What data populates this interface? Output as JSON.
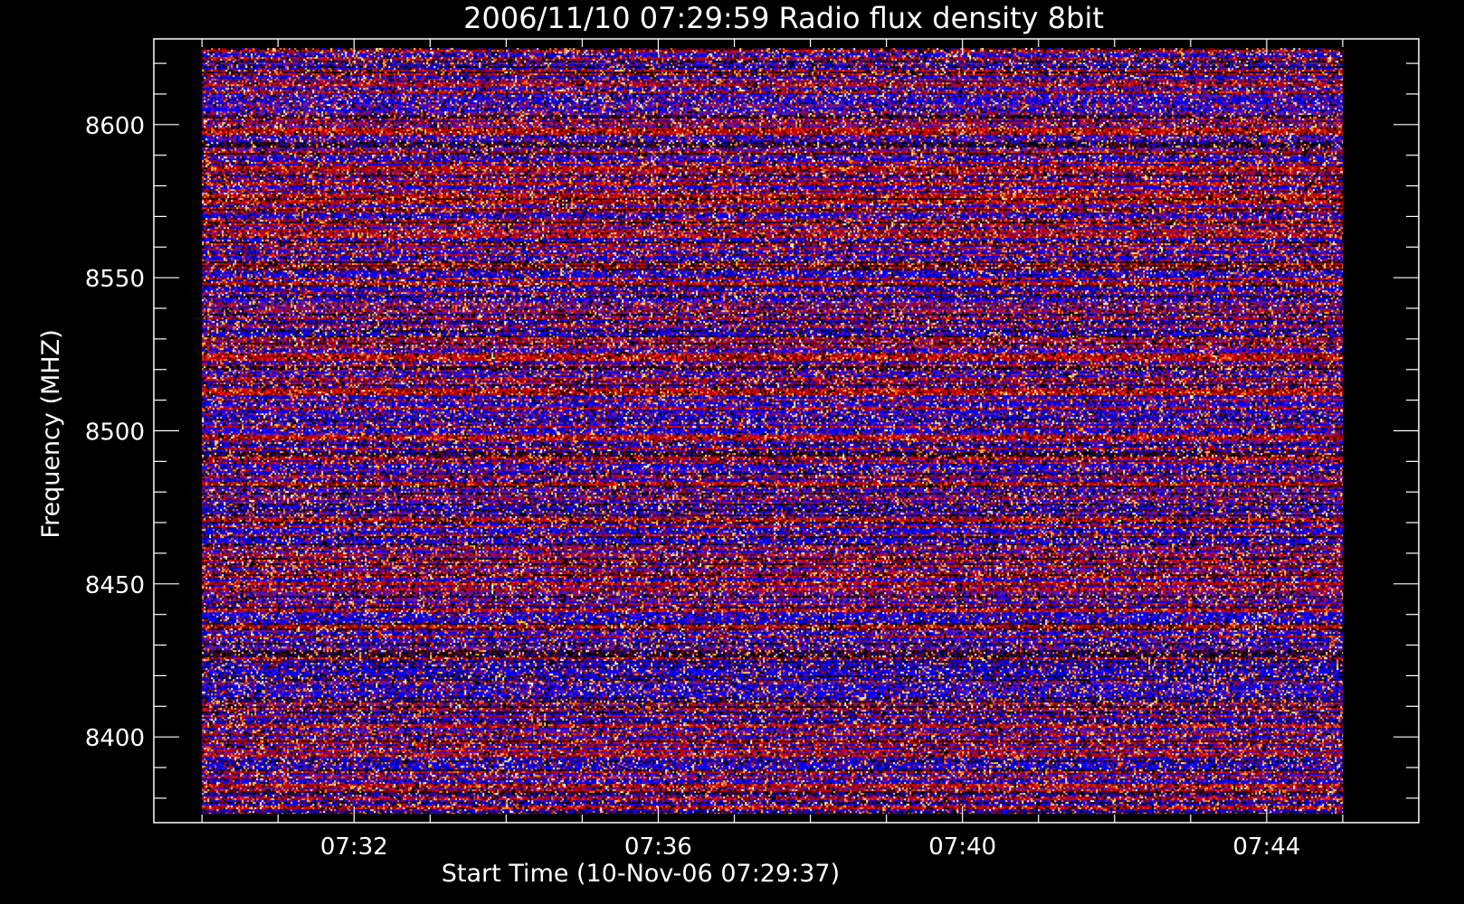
{
  "chart_data": {
    "type": "heatmap",
    "title": "2006/11/10 07:29:59 Radio flux density 8bit",
    "xlabel": "Start Time (10-Nov-06 07:29:37)",
    "ylabel": "Frequency (MHZ)",
    "x_tick_labels": [
      "07:32",
      "07:36",
      "07:40",
      "07:44"
    ],
    "y_tick_labels": [
      "8400",
      "8450",
      "8500",
      "8550",
      "8600"
    ],
    "y_ticks": [
      8400,
      8450,
      8500,
      8550,
      8600
    ],
    "xlim": [
      "07:29:22",
      "07:46:00"
    ],
    "ylim": [
      8628,
      8372
    ],
    "data_time_range": [
      "07:30:00",
      "07:45:00"
    ],
    "data_freq_range": [
      8375,
      8625
    ],
    "colors": {
      "background": "#000000",
      "axes": "#ffffff",
      "text": "#ffffff",
      "colormap": [
        "#000000",
        "#3a0a2a",
        "#7a0000",
        "#c80000",
        "#ff2a00",
        "#ff7a20",
        "#ffd060",
        "#ffffff",
        "#3300cc",
        "#0000ff",
        "#5a1ab4"
      ]
    },
    "grid": false,
    "legend": "none",
    "notes": "Noisy spectrogram of quantized flux values; horizontal banding across frequencies, no distinct bursts."
  }
}
